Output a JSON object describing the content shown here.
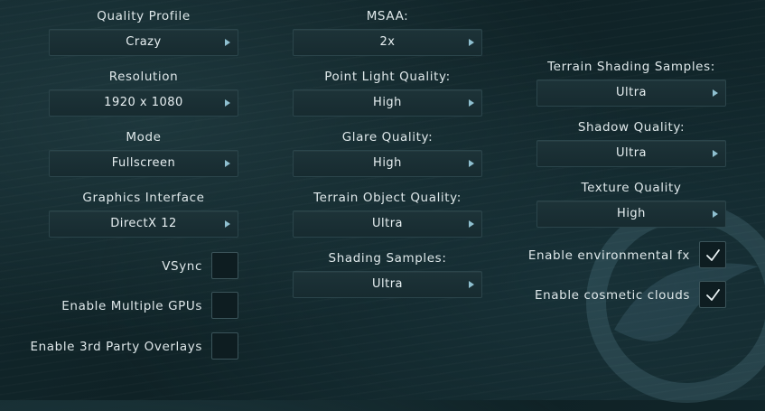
{
  "icons": {
    "dropdown_arrow": "right-triangle-icon",
    "check": "checkmark-icon",
    "logo": "swirl-logo"
  },
  "colors": {
    "background": "#13292e",
    "control_bg": "#1b3035",
    "arrow": "#8fc0d0",
    "check": "#e8f0f2"
  },
  "col1": {
    "quality_profile": {
      "label": "Quality Profile",
      "value": "Crazy"
    },
    "resolution": {
      "label": "Resolution",
      "value": "1920 x 1080"
    },
    "mode": {
      "label": "Mode",
      "value": "Fullscreen"
    },
    "graphics_interface": {
      "label": "Graphics Interface",
      "value": "DirectX 12"
    },
    "vsync": {
      "label": "VSync",
      "checked": false
    },
    "multiple_gpus": {
      "label": "Enable Multiple GPUs",
      "checked": false
    },
    "third_party_overlays": {
      "label": "Enable 3rd Party Overlays",
      "checked": false
    }
  },
  "col2": {
    "msaa": {
      "label": "MSAA:",
      "value": "2x"
    },
    "point_light_quality": {
      "label": "Point Light Quality:",
      "value": "High"
    },
    "glare_quality": {
      "label": "Glare Quality:",
      "value": "High"
    },
    "terrain_object_quality": {
      "label": "Terrain Object Quality:",
      "value": "Ultra"
    },
    "shading_samples": {
      "label": "Shading Samples:",
      "value": "Ultra"
    }
  },
  "col3": {
    "terrain_shading_samples": {
      "label": "Terrain Shading Samples:",
      "value": "Ultra"
    },
    "shadow_quality": {
      "label": "Shadow Quality:",
      "value": "Ultra"
    },
    "texture_quality": {
      "label": "Texture Quality",
      "value": "High"
    },
    "environmental_fx": {
      "label": "Enable environmental fx",
      "checked": true
    },
    "cosmetic_clouds": {
      "label": "Enable cosmetic clouds",
      "checked": true
    }
  }
}
